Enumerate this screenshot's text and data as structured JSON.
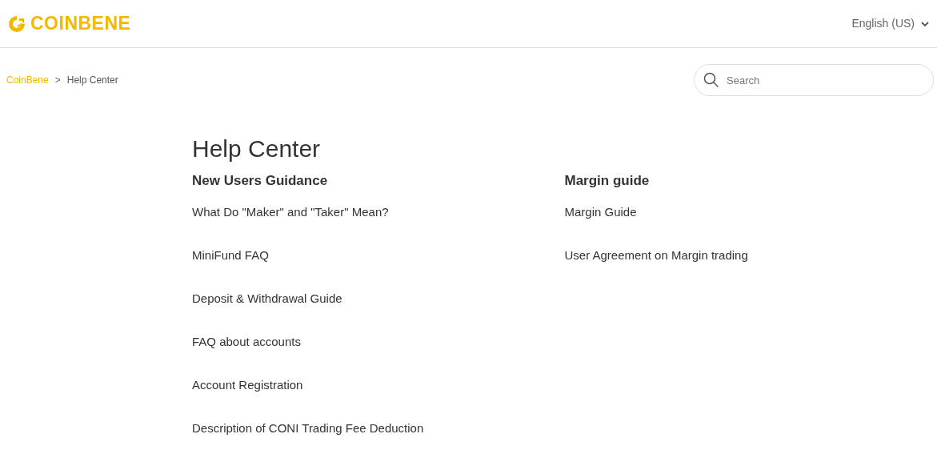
{
  "header": {
    "logo": "COINBENE",
    "language": "English (US)"
  },
  "breadcrumb": [
    {
      "label": "CoinBene",
      "kind": "link"
    },
    {
      "label": ">",
      "kind": "separator"
    },
    {
      "label": "Help Center",
      "kind": "current"
    }
  ],
  "search": {
    "placeholder": "Search"
  },
  "title": "Help Center",
  "sections": [
    {
      "title": "New Users Guidance",
      "articles": [
        "What Do \"Maker\" and \"Taker\" Mean?",
        "MiniFund FAQ",
        "Deposit & Withdrawal Guide",
        "FAQ about accounts",
        "Account Registration",
        "Description of CONI Trading Fee Deduction"
      ]
    },
    {
      "title": "Margin guide",
      "articles": [
        "Margin Guide",
        "User Agreement on Margin trading"
      ]
    }
  ]
}
